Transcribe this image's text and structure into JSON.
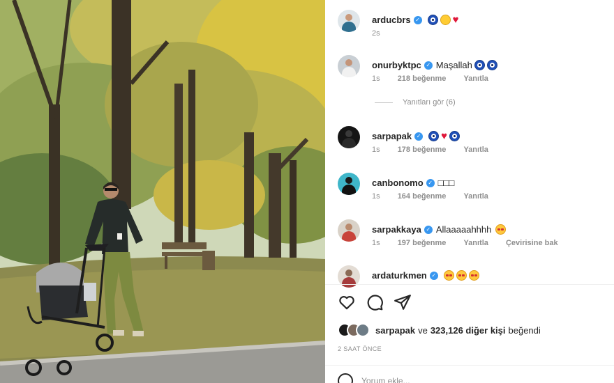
{
  "comments": [
    {
      "username": "arducbrs",
      "text": "",
      "time": "2s",
      "likes": "",
      "reply": "",
      "translate": "",
      "avatar_color": "#2f6f8f"
    },
    {
      "username": "onurbyktpc",
      "text": "Maşallah",
      "time": "1s",
      "likes": "218 beğenme",
      "reply": "Yanıtla",
      "translate": "",
      "avatar_color": "#6d7c86"
    },
    {
      "username": "sarpapak",
      "text": "",
      "time": "1s",
      "likes": "178 beğenme",
      "reply": "Yanıtla",
      "translate": "",
      "avatar_color": "#1b1b1b"
    },
    {
      "username": "canbonomo",
      "text": "□□□",
      "time": "1s",
      "likes": "164 beğenme",
      "reply": "Yanıtla",
      "translate": "",
      "avatar_color": "#3fb6c9"
    },
    {
      "username": "sarpakkaya",
      "text": "Allaaaaahhhh",
      "time": "1s",
      "likes": "197 beğenme",
      "reply": "Yanıtla",
      "translate": "Çevirisine bak",
      "avatar_color": "#7b6a5e"
    },
    {
      "username": "ardaturkmen",
      "text": "",
      "time": "",
      "likes": "",
      "reply": "",
      "translate": "",
      "avatar_color": "#8a7766"
    }
  ],
  "view_replies": "Yanıtları gör (6)",
  "likes_line": {
    "user": "sarpapak",
    "connector": "ve",
    "count": "323,126 diğer kişi",
    "suffix": "beğendi"
  },
  "post_time": "2 SAAT ÖNCE",
  "add_comment_placeholder": "Yorum ekle...",
  "icons": [
    "heart-icon",
    "comment-icon",
    "share-icon",
    "verified-icon",
    "nazar-emoji-icon",
    "smile-emoji-icon",
    "star-eyes-emoji-icon",
    "red-heart-emoji-icon",
    "emoji-picker-icon"
  ],
  "colors": {
    "verified": "#3897f0",
    "muted_text": "#8e8e8e",
    "heart": "#e0173a"
  }
}
